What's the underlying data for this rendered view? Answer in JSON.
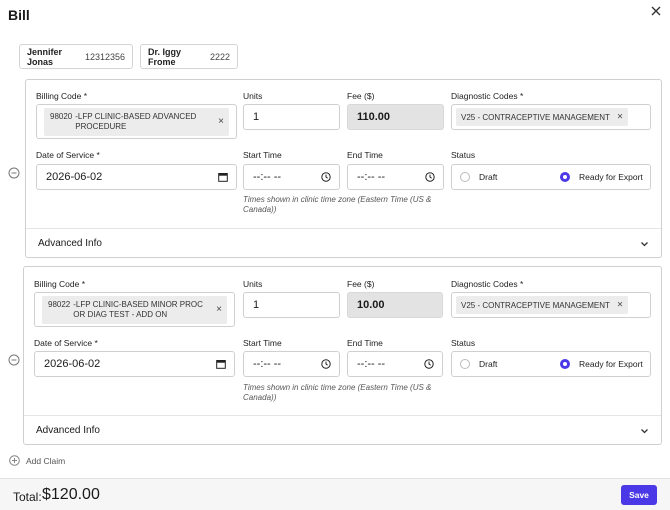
{
  "modal": {
    "title": "Bill"
  },
  "participants": [
    {
      "name": "Jennifer Jonas",
      "id": "12312356"
    },
    {
      "name": "Dr. Iggy Frome",
      "id": "2222"
    }
  ],
  "labels": {
    "billing_code": "Billing Code",
    "units": "Units",
    "fee": "Fee ($)",
    "diagnostic_codes": "Diagnostic Codes",
    "date_of_service": "Date of Service",
    "start_time": "Start Time",
    "end_time": "End Time",
    "status": "Status",
    "required_marker": "*",
    "time_hint": "Times shown in clinic time zone (Eastern Time (US & Canada))",
    "advanced_info": "Advanced Info",
    "draft": "Draft",
    "ready_for_export": "Ready for Export"
  },
  "claims": [
    {
      "billing_code": {
        "code": "98020",
        "description": "-LFP CLINIC-BASED ADVANCED PROCEDURE"
      },
      "units": "1",
      "fee": "110.00",
      "diagnostic_code": "V25 - CONTRACEPTIVE MANAGEMENT",
      "date_of_service": "2026-06-02",
      "start_time": "--:-- --",
      "end_time": "--:-- --",
      "status": "ready_for_export"
    },
    {
      "billing_code": {
        "code": "98022",
        "description": "-LFP CLINIC-BASED MINOR PROC OR DIAG TEST - ADD ON"
      },
      "units": "1",
      "fee": "10.00",
      "diagnostic_code": "V25 - CONTRACEPTIVE MANAGEMENT",
      "date_of_service": "2026-06-02",
      "start_time": "--:-- --",
      "end_time": "--:-- --",
      "status": "ready_for_export"
    }
  ],
  "add_claim_label": "Add Claim",
  "footer": {
    "total_label": "Total:",
    "total_value": "$120.00",
    "save_label": "Save"
  },
  "colors": {
    "accent": "#4b38e6"
  },
  "icons": [
    "close-icon",
    "minus-circle-icon",
    "calendar-icon",
    "clock-icon",
    "chevron-down-icon",
    "plus-circle-icon"
  ]
}
